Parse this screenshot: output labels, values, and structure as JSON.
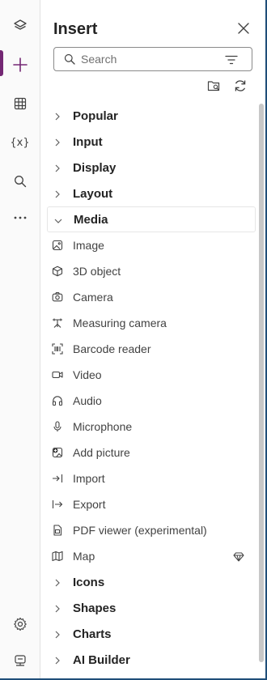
{
  "panel": {
    "title": "Insert",
    "search_placeholder": "Search"
  },
  "rail": {
    "items": [
      {
        "name": "tree-view",
        "icon": "layers-icon",
        "active": false
      },
      {
        "name": "insert",
        "icon": "plus-icon",
        "active": true
      },
      {
        "name": "data",
        "icon": "table-icon",
        "active": false
      },
      {
        "name": "variables",
        "icon": "variables-icon",
        "label": "{x}",
        "active": false
      },
      {
        "name": "search",
        "icon": "search-icon",
        "active": false
      },
      {
        "name": "more",
        "icon": "more-icon",
        "active": false
      },
      {
        "name": "settings",
        "icon": "gear-icon",
        "active": false
      },
      {
        "name": "virtual-agent",
        "icon": "bot-icon",
        "active": false
      }
    ],
    "active_color": "#742774"
  },
  "categories_before": [
    {
      "label": "Popular"
    },
    {
      "label": "Input"
    },
    {
      "label": "Display"
    },
    {
      "label": "Layout"
    }
  ],
  "media": {
    "label": "Media",
    "items": [
      {
        "label": "Image",
        "icon": "image-icon"
      },
      {
        "label": "3D object",
        "icon": "cube-icon"
      },
      {
        "label": "Camera",
        "icon": "camera-icon"
      },
      {
        "label": "Measuring camera",
        "icon": "measure-icon"
      },
      {
        "label": "Barcode reader",
        "icon": "barcode-icon"
      },
      {
        "label": "Video",
        "icon": "video-icon"
      },
      {
        "label": "Audio",
        "icon": "headphones-icon"
      },
      {
        "label": "Microphone",
        "icon": "microphone-icon"
      },
      {
        "label": "Add picture",
        "icon": "add-picture-icon"
      },
      {
        "label": "Import",
        "icon": "import-icon"
      },
      {
        "label": "Export",
        "icon": "export-icon"
      },
      {
        "label": "PDF viewer (experimental)",
        "icon": "pdf-icon"
      },
      {
        "label": "Map",
        "icon": "map-icon",
        "premium": true
      }
    ]
  },
  "categories_after": [
    {
      "label": "Icons"
    },
    {
      "label": "Shapes"
    },
    {
      "label": "Charts"
    },
    {
      "label": "AI Builder"
    }
  ]
}
